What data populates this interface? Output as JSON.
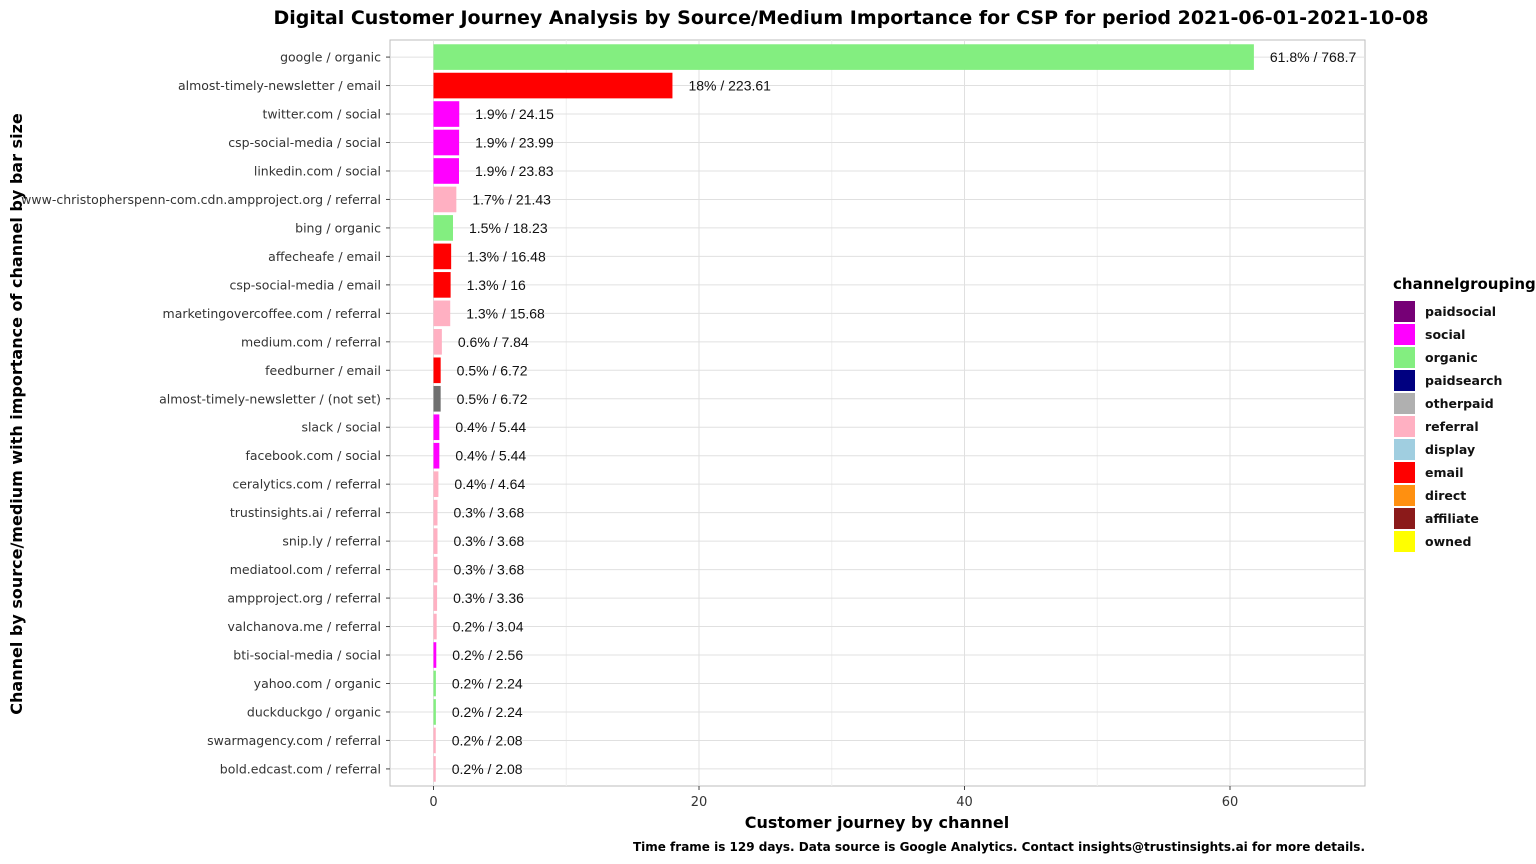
{
  "chart_data": {
    "type": "bar",
    "orientation": "horizontal",
    "title": "Digital Customer Journey Analysis by Source/Medium Importance for CSP for period 2021-06-01-2021-10-08",
    "xlabel": "Customer journey by channel",
    "ylabel": "Channel by source/medium with importance of channel by bar size",
    "caption": "Time frame is 129 days. Data source is Google Analytics. Contact insights@trustinsights.ai for more details.",
    "xlim": [
      0,
      70
    ],
    "xticks": [
      0,
      20,
      40,
      60
    ],
    "grid": true,
    "legend": {
      "title": "channelgrouping",
      "placement": "right",
      "items": [
        {
          "name": "paidsocial",
          "color": "#760076"
        },
        {
          "name": "social",
          "color": "#FF00FF"
        },
        {
          "name": "organic",
          "color": "#83EE80"
        },
        {
          "name": "paidsearch",
          "color": "#000080"
        },
        {
          "name": "otherpaid",
          "color": "#B0B0B0"
        },
        {
          "name": "referral",
          "color": "#FFB0C2"
        },
        {
          "name": "display",
          "color": "#A0CEE0"
        },
        {
          "name": "email",
          "color": "#FF0000"
        },
        {
          "name": "direct",
          "color": "#FF9010"
        },
        {
          "name": "affiliate",
          "color": "#8B1A1A"
        },
        {
          "name": "owned",
          "color": "#FFFF00"
        }
      ]
    },
    "unset_color": "#707070",
    "bars": [
      {
        "label": "google / organic",
        "channel": "organic",
        "percent": 61.8,
        "value": 768.7,
        "text": "61.8% / 768.7"
      },
      {
        "label": "almost-timely-newsletter / email",
        "channel": "email",
        "percent": 18.0,
        "value": 223.61,
        "text": "18% / 223.61"
      },
      {
        "label": "twitter.com / social",
        "channel": "social",
        "percent": 1.94,
        "value": 24.15,
        "text": "1.9% / 24.15"
      },
      {
        "label": "csp-social-media / social",
        "channel": "social",
        "percent": 1.93,
        "value": 23.99,
        "text": "1.9% / 23.99"
      },
      {
        "label": "linkedin.com / social",
        "channel": "social",
        "percent": 1.92,
        "value": 23.83,
        "text": "1.9% / 23.83"
      },
      {
        "label": "www-christopherspenn-com.cdn.ampproject.org / referral",
        "channel": "referral",
        "percent": 1.72,
        "value": 21.43,
        "text": "1.7% / 21.43"
      },
      {
        "label": "bing / organic",
        "channel": "organic",
        "percent": 1.47,
        "value": 18.23,
        "text": "1.5% / 18.23"
      },
      {
        "label": "affecheafe / email",
        "channel": "email",
        "percent": 1.33,
        "value": 16.48,
        "text": "1.3% / 16.48"
      },
      {
        "label": "csp-social-media / email",
        "channel": "email",
        "percent": 1.29,
        "value": 16,
        "text": "1.3% / 16"
      },
      {
        "label": "marketingovercoffee.com / referral",
        "channel": "referral",
        "percent": 1.26,
        "value": 15.68,
        "text": "1.3% / 15.68"
      },
      {
        "label": "medium.com / referral",
        "channel": "referral",
        "percent": 0.63,
        "value": 7.84,
        "text": "0.6% / 7.84"
      },
      {
        "label": "feedburner / email",
        "channel": "email",
        "percent": 0.54,
        "value": 6.72,
        "text": "0.5% / 6.72"
      },
      {
        "label": "almost-timely-newsletter / (not set)",
        "channel": "(not set)",
        "percent": 0.54,
        "value": 6.72,
        "text": "0.5% / 6.72"
      },
      {
        "label": "slack / social",
        "channel": "social",
        "percent": 0.44,
        "value": 5.44,
        "text": "0.4% / 5.44"
      },
      {
        "label": "facebook.com / social",
        "channel": "social",
        "percent": 0.44,
        "value": 5.44,
        "text": "0.4% / 5.44"
      },
      {
        "label": "ceralytics.com / referral",
        "channel": "referral",
        "percent": 0.37,
        "value": 4.64,
        "text": "0.4% / 4.64"
      },
      {
        "label": "trustinsights.ai / referral",
        "channel": "referral",
        "percent": 0.3,
        "value": 3.68,
        "text": "0.3% / 3.68"
      },
      {
        "label": "snip.ly / referral",
        "channel": "referral",
        "percent": 0.3,
        "value": 3.68,
        "text": "0.3% / 3.68"
      },
      {
        "label": "mediatool.com / referral",
        "channel": "referral",
        "percent": 0.3,
        "value": 3.68,
        "text": "0.3% / 3.68"
      },
      {
        "label": "ampproject.org / referral",
        "channel": "referral",
        "percent": 0.27,
        "value": 3.36,
        "text": "0.3% / 3.36"
      },
      {
        "label": "valchanova.me / referral",
        "channel": "referral",
        "percent": 0.24,
        "value": 3.04,
        "text": "0.2% / 3.04"
      },
      {
        "label": "bti-social-media / social",
        "channel": "social",
        "percent": 0.21,
        "value": 2.56,
        "text": "0.2% / 2.56"
      },
      {
        "label": "yahoo.com / organic",
        "channel": "organic",
        "percent": 0.18,
        "value": 2.24,
        "text": "0.2% / 2.24"
      },
      {
        "label": "duckduckgo / organic",
        "channel": "organic",
        "percent": 0.18,
        "value": 2.24,
        "text": "0.2% / 2.24"
      },
      {
        "label": "swarmagency.com / referral",
        "channel": "referral",
        "percent": 0.17,
        "value": 2.08,
        "text": "0.2% / 2.08"
      },
      {
        "label": "bold.edcast.com / referral",
        "channel": "referral",
        "percent": 0.17,
        "value": 2.08,
        "text": "0.2% / 2.08"
      }
    ]
  }
}
